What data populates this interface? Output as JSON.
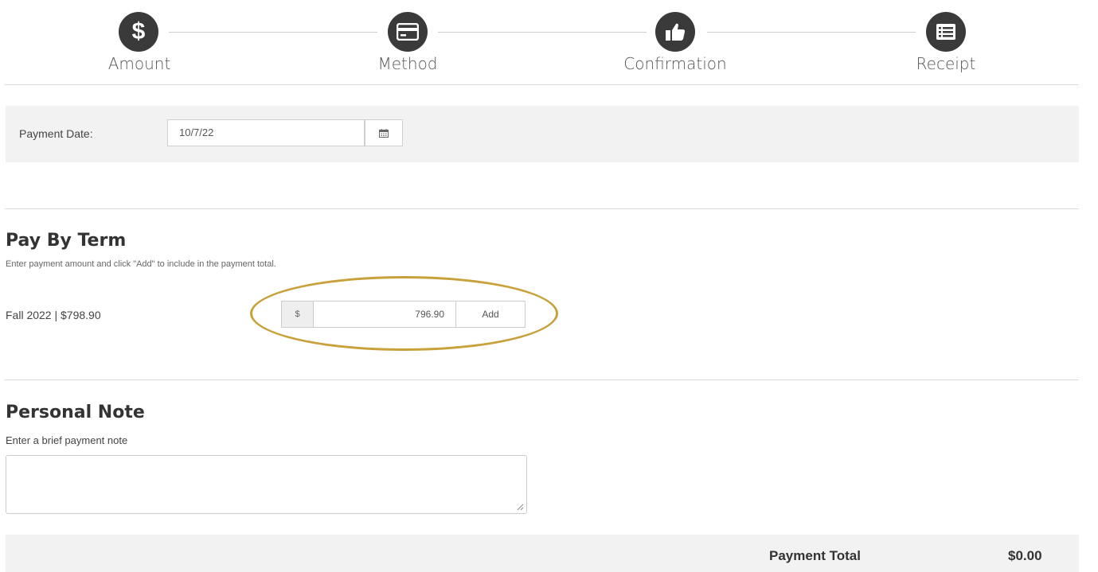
{
  "steps": [
    {
      "label": "Amount",
      "icon": "dollar-icon"
    },
    {
      "label": "Method",
      "icon": "credit-card-icon"
    },
    {
      "label": "Confirmation",
      "icon": "thumbs-up-icon"
    },
    {
      "label": "Receipt",
      "icon": "list-icon"
    }
  ],
  "payment_date": {
    "label": "Payment Date:",
    "value": "10/7/22",
    "button_icon": "calendar-icon"
  },
  "pay_by_term": {
    "title": "Pay By Term",
    "subtitle": "Enter payment amount and click \"Add\" to include in the payment total.",
    "term_label": "Fall 2022 | $798.90",
    "currency_symbol": "$",
    "amount_value": "796.90",
    "add_label": "Add",
    "highlight_color": "#c9a13b"
  },
  "personal_note": {
    "title": "Personal Note",
    "subtitle": "Enter a brief payment note",
    "value": ""
  },
  "total": {
    "label": "Payment Total",
    "value": "$0.00"
  },
  "colors": {
    "step_circle": "#3a3a3a",
    "panel": "#f2f2f2"
  }
}
